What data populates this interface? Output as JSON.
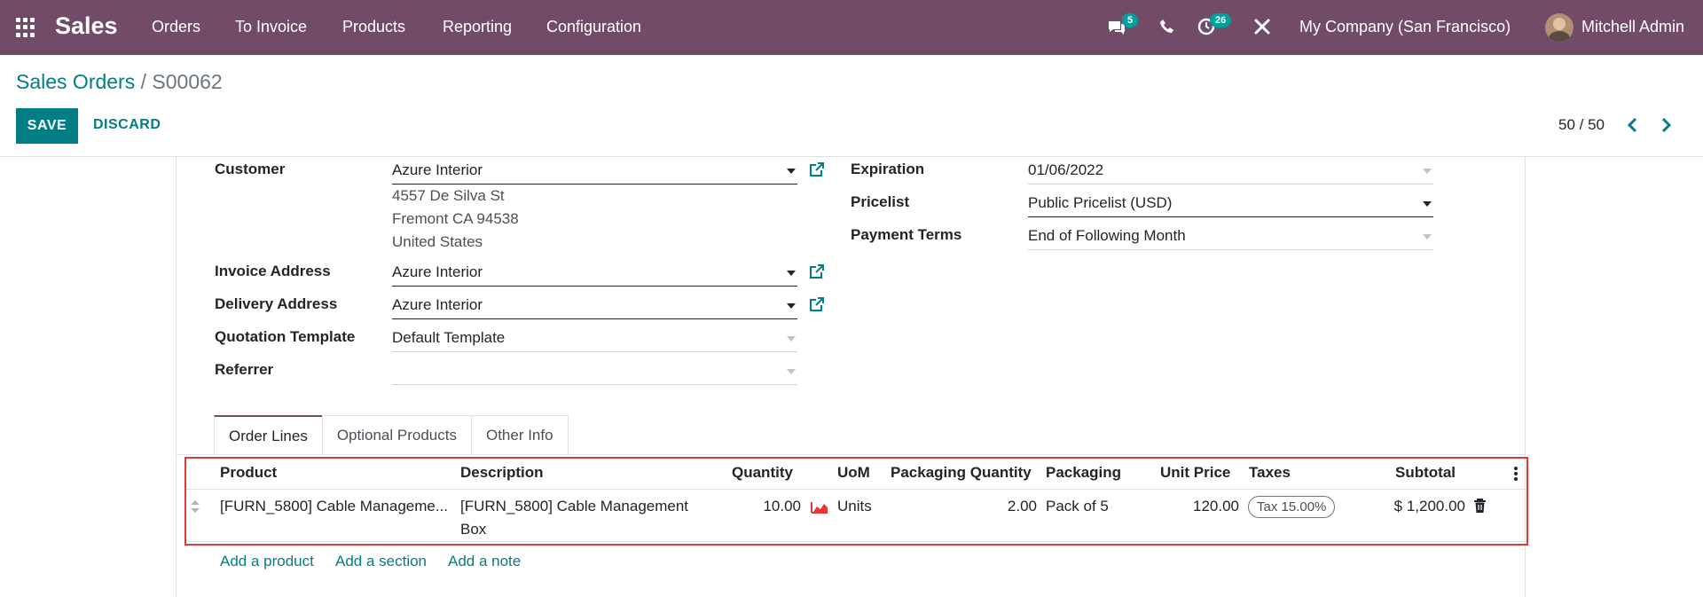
{
  "topbar": {
    "app_name": "Sales",
    "nav": [
      "Orders",
      "To Invoice",
      "Products",
      "Reporting",
      "Configuration"
    ],
    "chat_badge": "5",
    "activity_badge": "26",
    "company": "My Company (San Francisco)",
    "user": "Mitchell Admin",
    "bar_color": "#714b67"
  },
  "control_panel": {
    "breadcrumb_parent": "Sales Orders",
    "breadcrumb_sep": "/",
    "breadcrumb_current": "S00062",
    "save_label": "SAVE",
    "discard_label": "DISCARD",
    "pager": "50 / 50"
  },
  "form": {
    "customer_label": "Customer",
    "customer_value": "Azure Interior",
    "address_line1": "4557 De Silva St",
    "address_line2": "Fremont CA 94538",
    "address_line3": "United States",
    "invoice_label": "Invoice Address",
    "invoice_value": "Azure Interior",
    "delivery_label": "Delivery Address",
    "delivery_value": "Azure Interior",
    "template_label": "Quotation Template",
    "template_value": "Default Template",
    "referrer_label": "Referrer",
    "referrer_value": "",
    "expiration_label": "Expiration",
    "expiration_value": "01/06/2022",
    "pricelist_label": "Pricelist",
    "pricelist_value": "Public Pricelist (USD)",
    "terms_label": "Payment Terms",
    "terms_value": "End of Following Month"
  },
  "tabs": [
    "Order Lines",
    "Optional Products",
    "Other Info"
  ],
  "order_lines": {
    "columns": [
      "Product",
      "Description",
      "Quantity",
      "UoM",
      "Packaging Quantity",
      "Packaging",
      "Unit Price",
      "Taxes",
      "Subtotal"
    ],
    "rows": [
      {
        "product": "[FURN_5800] Cable Manageme...",
        "description_line1": "[FURN_5800] Cable Management",
        "description_line2": "Box",
        "quantity": "10.00",
        "uom": "Units",
        "packaging_qty": "2.00",
        "packaging": "Pack of 5",
        "unit_price": "120.00",
        "tax": "Tax 15.00%",
        "subtotal": "$ 1,200.00"
      }
    ],
    "add_product": "Add a product",
    "add_section": "Add a section",
    "add_note": "Add a note"
  },
  "accent_color": "#017e84",
  "highlight_color": "#e53935"
}
